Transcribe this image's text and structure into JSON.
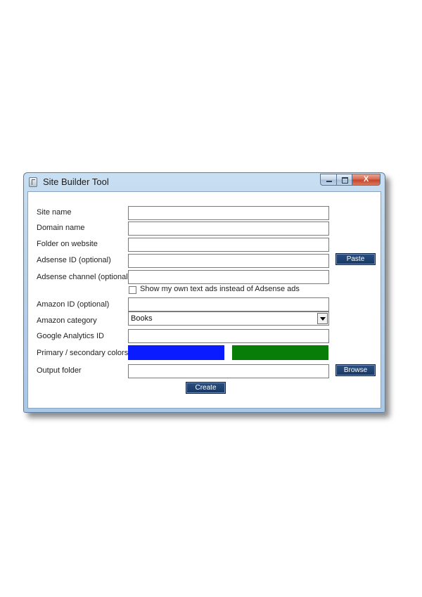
{
  "window": {
    "title": "Site Builder Tool",
    "close_glyph": "X"
  },
  "form": {
    "site_name": {
      "label": "Site name",
      "value": ""
    },
    "domain_name": {
      "label": "Domain name",
      "value": ""
    },
    "folder_on_website": {
      "label": "Folder on website",
      "value": ""
    },
    "adsense_id": {
      "label": "Adsense ID (optional)",
      "value": ""
    },
    "adsense_channel": {
      "label": "Adsense channel (optional)",
      "value": ""
    },
    "own_text_ads": {
      "label": "Show my own text ads instead of Adsense ads",
      "checked": false
    },
    "amazon_id": {
      "label": "Amazon ID (optional)",
      "value": ""
    },
    "amazon_category": {
      "label": "Amazon category",
      "selected": "Books"
    },
    "google_analytics_id": {
      "label": "Google Analytics ID",
      "value": ""
    },
    "colors": {
      "label": "Primary / secondary colors",
      "primary": "#0a1bff",
      "secondary": "#087d08"
    },
    "output_folder": {
      "label": "Output folder",
      "value": ""
    }
  },
  "buttons": {
    "paste": "Paste",
    "browse": "Browse",
    "create": "Create"
  },
  "icons": {
    "app": "app-icon",
    "minimize": "minimize-icon",
    "maximize": "maximize-icon",
    "close": "close-icon",
    "dropdown": "chevron-down-icon"
  }
}
